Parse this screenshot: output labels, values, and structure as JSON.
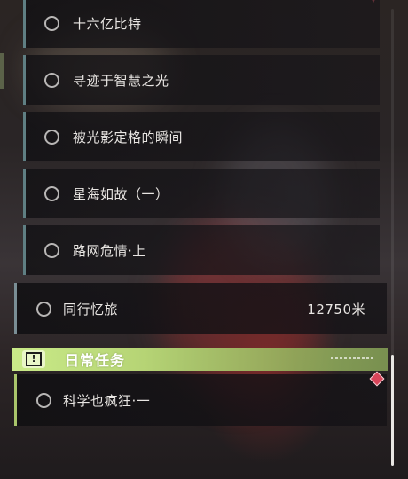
{
  "quest_list": {
    "sub_items": [
      {
        "label": "十六亿比特"
      },
      {
        "label": "寻迹于智慧之光"
      },
      {
        "label": "被光影定格的瞬间"
      },
      {
        "label": "星海如故（一）"
      },
      {
        "label": "路网危情·上"
      }
    ],
    "main_item": {
      "label": "同行忆旅",
      "distance": "12750米"
    },
    "daily_category": {
      "title": "日常任务",
      "icon_name": "exclamation-box-icon",
      "icon_glyph": "!",
      "accent_color": "#c9ea88"
    },
    "daily_items": [
      {
        "label": "科学也疯狂·一"
      }
    ]
  },
  "colors": {
    "row_border": "#5f7f83",
    "daily_border": "#a9c56b",
    "tracking_marker": "#d8455a"
  }
}
